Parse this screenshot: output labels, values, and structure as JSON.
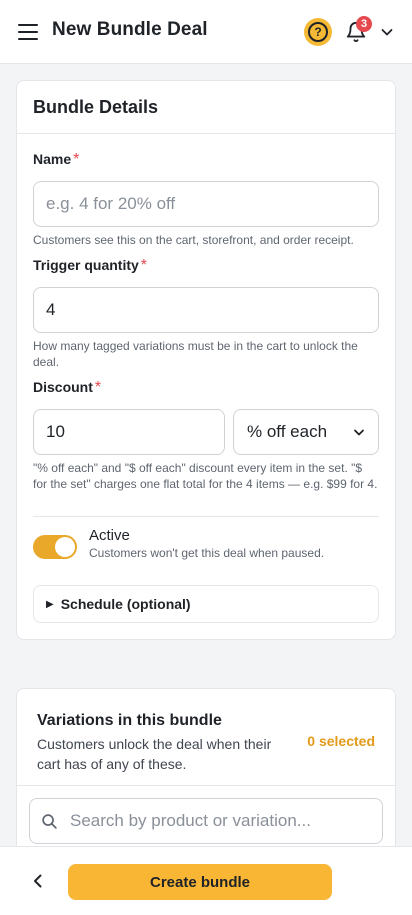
{
  "header": {
    "title": "New Bundle Deal",
    "help_icon": "question-circle-icon",
    "help_glyph": "?",
    "notifications_icon": "bell-icon",
    "notification_count": "3"
  },
  "bundle_details": {
    "title": "Bundle Details",
    "name": {
      "label": "Name",
      "required_mark": "*",
      "value": "",
      "placeholder": "e.g. 4 for 20% off",
      "help": "Customers see this on the cart, storefront, and order receipt."
    },
    "trigger_quantity": {
      "label": "Trigger quantity",
      "required_mark": "*",
      "value": "4",
      "help": "How many tagged variations must be in the cart to unlock the deal."
    },
    "discount": {
      "label": "Discount",
      "required_mark": "*",
      "value": "10",
      "type_selected": "% off each",
      "help": "\"% off each\" and \"$ off each\" discount every item in the set. \"$ for the set\" charges one flat total for the 4 items — e.g. $99 for 4."
    },
    "active": {
      "label": "Active",
      "on": true,
      "help": "Customers won't get this deal when paused."
    },
    "schedule": {
      "caret": "▶",
      "label": "Schedule (optional)"
    }
  },
  "variations": {
    "title": "Variations in this bundle",
    "subtitle": "Customers unlock the deal when their cart has of any of these.",
    "selected_count": "0 selected",
    "search_placeholder": "Search by product or variation..."
  },
  "footer": {
    "create_label": "Create bundle"
  },
  "colors": {
    "accent": "#f9b635",
    "toggle_on": "#e9a82a",
    "required": "#e5484d",
    "selected_count": "#e29a18",
    "badge": "#e5484d"
  }
}
